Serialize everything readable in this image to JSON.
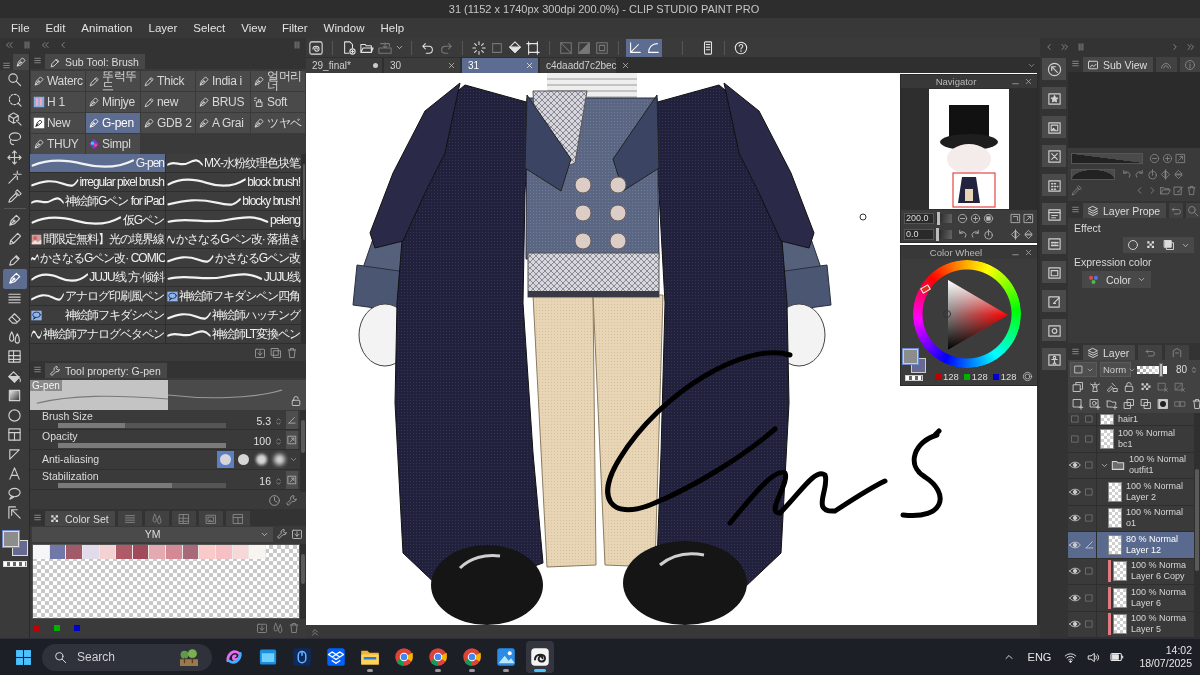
{
  "window": {
    "title": "31 (1152 x 1740px 300dpi 200.0%) - CLIP STUDIO PAINT PRO"
  },
  "menu": [
    "File",
    "Edit",
    "Animation",
    "Layer",
    "Select",
    "View",
    "Filter",
    "Window",
    "Help"
  ],
  "toolbar": {
    "groups": [
      {
        "buttons": [
          {
            "kind": "logo",
            "on": false,
            "disabled": false
          }
        ]
      },
      {
        "buttons": [
          {
            "kind": "new",
            "on": false,
            "disabled": false
          },
          {
            "kind": "open",
            "on": false,
            "disabled": false
          },
          {
            "kind": "save",
            "on": false,
            "disabled": true
          },
          {
            "kind": "caret",
            "on": false,
            "disabled": false
          }
        ]
      },
      {
        "buttons": [
          {
            "kind": "undo",
            "on": false,
            "disabled": false
          },
          {
            "kind": "redo",
            "on": false,
            "disabled": true
          }
        ]
      },
      {
        "buttons": [
          {
            "kind": "spinner",
            "on": false,
            "disabled": false
          },
          {
            "kind": "transform",
            "on": false,
            "disabled": true
          },
          {
            "kind": "fillsel",
            "on": false,
            "disabled": false
          },
          {
            "kind": "crop",
            "on": false,
            "disabled": false
          }
        ]
      },
      {
        "buttons": [
          {
            "kind": "gridoff",
            "on": false,
            "disabled": true
          },
          {
            "kind": "halfbox",
            "on": false,
            "disabled": true
          },
          {
            "kind": "innerbox",
            "on": false,
            "disabled": true
          }
        ]
      },
      {
        "buttons": [
          {
            "kind": "snapline",
            "on": true,
            "disabled": false
          },
          {
            "kind": "snapcurve",
            "on": true,
            "disabled": false
          }
        ]
      },
      {
        "buttons": [
          {
            "kind": "device",
            "on": false,
            "disabled": false
          }
        ]
      },
      {
        "buttons": [
          {
            "kind": "help",
            "on": false,
            "disabled": false
          }
        ]
      }
    ]
  },
  "document_tabs": [
    {
      "label": "29_final*",
      "selected": false,
      "modified": true
    },
    {
      "label": "30",
      "selected": false,
      "modified": false
    },
    {
      "label": "31",
      "selected": true,
      "modified": false
    },
    {
      "label": "c4daadd7c2bec",
      "selected": false,
      "modified": false
    }
  ],
  "tools": [
    {
      "kind": "zoom",
      "selected": false
    },
    {
      "kind": "marquee",
      "selected": false
    },
    {
      "kind": "object",
      "selected": false
    },
    {
      "kind": "lasso",
      "selected": false
    },
    {
      "kind": "move",
      "selected": false
    },
    {
      "kind": "wand",
      "selected": false
    },
    {
      "kind": "dropper",
      "selected": false
    },
    {
      "kind": "pen",
      "selected": false
    },
    {
      "kind": "pencil",
      "selected": false
    },
    {
      "kind": "brush",
      "selected": false
    },
    {
      "kind": "pen",
      "selected": true
    },
    {
      "kind": "lines",
      "selected": false
    },
    {
      "kind": "eraser",
      "selected": false
    },
    {
      "kind": "blend",
      "selected": false
    },
    {
      "kind": "frame",
      "selected": false
    },
    {
      "kind": "fill",
      "selected": false
    },
    {
      "kind": "gradient",
      "selected": false
    },
    {
      "kind": "ellipse",
      "selected": false
    },
    {
      "kind": "panel",
      "selected": false
    },
    {
      "kind": "ruler",
      "selected": false
    },
    {
      "kind": "text",
      "selected": false
    },
    {
      "kind": "balloon",
      "selected": false
    },
    {
      "kind": "correct",
      "selected": false
    }
  ],
  "tool_colors": [
    {
      "kind": "main",
      "color": "#8c8c8c"
    },
    {
      "kind": "sub",
      "color": "#666a93"
    }
  ],
  "sub_tool": {
    "title": "Sub Tool: Brush",
    "groups": [
      {
        "label": "Waterc",
        "kind": "pen",
        "selected": false
      },
      {
        "label": "뚜럭뚜드",
        "kind": "marker",
        "selected": false
      },
      {
        "label": "Thick",
        "kind": "marker",
        "selected": false
      },
      {
        "label": "India i",
        "kind": "pen",
        "selected": false
      },
      {
        "label": "얼머리너",
        "kind": "pen",
        "selected": false
      },
      {
        "label": "H 1",
        "kind": "badge",
        "selected": false
      },
      {
        "label": "Minjye",
        "kind": "pen",
        "selected": false
      },
      {
        "label": "new",
        "kind": "marker",
        "selected": false
      },
      {
        "label": "BRUS",
        "kind": "pen",
        "selected": false
      },
      {
        "label": "Soft",
        "kind": "airbrush",
        "selected": false
      },
      {
        "label": "New",
        "kind": "tile",
        "selected": false
      },
      {
        "label": "G-pen",
        "kind": "pen",
        "selected": true
      },
      {
        "label": "GDB 2",
        "kind": "pen",
        "selected": false
      },
      {
        "label": "A Grai",
        "kind": "pen",
        "selected": false
      },
      {
        "label": "ツヤベ",
        "kind": "pen",
        "selected": false
      },
      {
        "label": "THUY",
        "kind": "pen",
        "selected": false
      },
      {
        "label": "Simpl",
        "kind": "blob",
        "selected": false
      }
    ],
    "brushes": [
      {
        "label": "G-pen",
        "kind": "stroke",
        "selected": true
      },
      {
        "label": "MX-水粉纹理色块笔",
        "kind": "stroke",
        "selected": false
      },
      {
        "label": "irregular pixel brush",
        "kind": "stroke",
        "selected": false
      },
      {
        "label": "block brush!",
        "kind": "stroke",
        "selected": false
      },
      {
        "label": "神絵師Gペン for iPad",
        "kind": "stroke",
        "selected": false
      },
      {
        "label": "blocky brush!",
        "kind": "stroke",
        "selected": false
      },
      {
        "label": "仮Gペン",
        "kind": "stroke",
        "selected": false
      },
      {
        "label": "peleng",
        "kind": "stroke",
        "selected": false
      },
      {
        "label": "間限定無料】光の境界線",
        "kind": "image",
        "selected": false
      },
      {
        "label": "かさなるGペン改· 落描き",
        "kind": "stroke",
        "selected": false
      },
      {
        "label": "かさなるGペン改· COMIC",
        "kind": "stroke",
        "selected": false
      },
      {
        "label": "かさなるGペン改",
        "kind": "stroke",
        "selected": false
      },
      {
        "label": "JUJU线 方·倾斜",
        "kind": "stroke",
        "selected": false
      },
      {
        "label": "JUJU线",
        "kind": "stroke",
        "selected": false
      },
      {
        "label": "アナログ印刷風ペン",
        "kind": "stroke",
        "selected": false
      },
      {
        "label": "神絵師フキダシペン四角",
        "kind": "balloon",
        "selected": false
      },
      {
        "label": "神絵師フキダシペン",
        "kind": "balloon",
        "selected": false
      },
      {
        "label": "神絵師ハッチング",
        "kind": "stroke",
        "selected": false
      },
      {
        "label": "神絵師アナログベタペン",
        "kind": "stroke",
        "selected": false
      },
      {
        "label": "神絵師LT変換ペン",
        "kind": "stroke",
        "selected": false
      }
    ]
  },
  "tool_property": {
    "title": "Tool property: G-pen",
    "preview_label": "G-pen",
    "properties": [
      {
        "kind": "slider",
        "label": "Brush Size",
        "value": "5.3",
        "level": 0.4
      },
      {
        "kind": "slider",
        "label": "Opacity",
        "value": "100",
        "level": 1
      },
      {
        "kind": "choice",
        "label": "Anti-aliasing",
        "options": [
          {
            "selected": true
          },
          {
            "selected": false
          },
          {
            "selected": false
          },
          {
            "selected": false
          }
        ]
      },
      {
        "kind": "slider",
        "label": "Stabilization",
        "value": "16",
        "level": 0.68
      }
    ]
  },
  "color_set": {
    "title": "Color Set",
    "set_name": "YM",
    "swatches": [
      {
        "color": "#f6f6f8"
      },
      {
        "color": "#7078a8"
      },
      {
        "color": "#a05a68"
      },
      {
        "color": "#e2dcea"
      },
      {
        "color": "#f2d2d2"
      },
      {
        "color": "#b05a68"
      },
      {
        "color": "#a04a5a"
      },
      {
        "color": "#e4aab2"
      },
      {
        "color": "#d48a94"
      },
      {
        "color": "#a86a7a"
      },
      {
        "color": "#f8caca"
      },
      {
        "color": "#f6c0c4"
      },
      {
        "color": "#f6d8d8"
      },
      {
        "color": "#f8f4f0"
      }
    ],
    "channel_marks": [
      {
        "color": "#c00000"
      },
      {
        "color": "#00b000"
      },
      {
        "color": "#0000d0"
      }
    ]
  },
  "navigator": {
    "title": "Navigator",
    "controls": [
      {
        "kind": "zoom",
        "value": "200.0",
        "level": 0.1
      },
      {
        "kind": "rotation",
        "value": "0.0",
        "level": 0.08
      }
    ]
  },
  "color_wheel": {
    "title": "Color Wheel",
    "colors": [
      {
        "kind": "main",
        "color": "#8c8c8c"
      },
      {
        "kind": "sub",
        "color": "#666a93"
      }
    ],
    "readings": [
      {
        "color": "#c00000",
        "value": "128"
      },
      {
        "color": "#00b000",
        "value": "128"
      },
      {
        "color": "#0000d0",
        "value": "128"
      }
    ]
  },
  "sub_view": {
    "title": "Sub View",
    "sliders": [
      {
        "kind": "zoom",
        "level": 1
      },
      {
        "kind": "rotation",
        "level": 1
      }
    ]
  },
  "layer_property": {
    "title": "Layer Prope",
    "effect_label": "Effect",
    "expression_label": "Expression color",
    "expression_value": "Color"
  },
  "layer_panel": {
    "title": "Layer",
    "blend_mode": "Norm",
    "opacity": "80",
    "level": 0.8,
    "layers": [
      {
        "kind": "layer",
        "name": "hair1",
        "visible": false,
        "selected": false,
        "editing": false
      },
      {
        "kind": "layer",
        "blend": "100 % Normal",
        "name": "bc1",
        "visible": false,
        "selected": false,
        "editing": false
      },
      {
        "kind": "folder",
        "blend": "100 % Normal",
        "name": "outfit1",
        "visible": true,
        "selected": false,
        "editing": false,
        "expanded": true,
        "children": [
          {
            "kind": "layer",
            "blend": "100 % Normal",
            "name": "Layer 2",
            "visible": true,
            "selected": false,
            "editing": false
          },
          {
            "kind": "layer",
            "blend": "100 % Normal",
            "name": "o1",
            "visible": true,
            "selected": false,
            "editing": false
          },
          {
            "kind": "layer",
            "blend": "80 % Normal",
            "name": "Layer 12",
            "visible": true,
            "selected": true,
            "editing": true
          },
          {
            "kind": "layer",
            "blend": "100 % Norma",
            "name": "Layer 6 Copy",
            "visible": true,
            "selected": false,
            "editing": false,
            "color": "#e07a80"
          },
          {
            "kind": "layer",
            "blend": "100 % Norma",
            "name": "Layer 6",
            "visible": true,
            "selected": false,
            "editing": false,
            "color": "#e07a80"
          },
          {
            "kind": "layer",
            "blend": "100 % Norma",
            "name": "Layer 5",
            "visible": true,
            "selected": false,
            "editing": false,
            "color": "#e07a80"
          }
        ]
      }
    ]
  },
  "taskbar": {
    "search_placeholder": "Search",
    "apps": [
      {
        "kind": "swirl",
        "running": false,
        "active": false
      },
      {
        "kind": "window",
        "running": false,
        "active": false
      },
      {
        "kind": "mouse",
        "running": false,
        "active": false
      },
      {
        "kind": "box",
        "running": false,
        "active": false
      },
      {
        "kind": "folder",
        "running": true,
        "active": false
      },
      {
        "kind": "browser",
        "running": false,
        "active": false
      },
      {
        "kind": "browser",
        "running": true,
        "active": false
      },
      {
        "kind": "browser",
        "running": true,
        "active": false
      },
      {
        "kind": "photos",
        "running": true,
        "active": false
      },
      {
        "kind": "paint",
        "running": true,
        "active": true
      }
    ],
    "language": "ENG",
    "time": "14:02",
    "date": "18/07/2025"
  }
}
